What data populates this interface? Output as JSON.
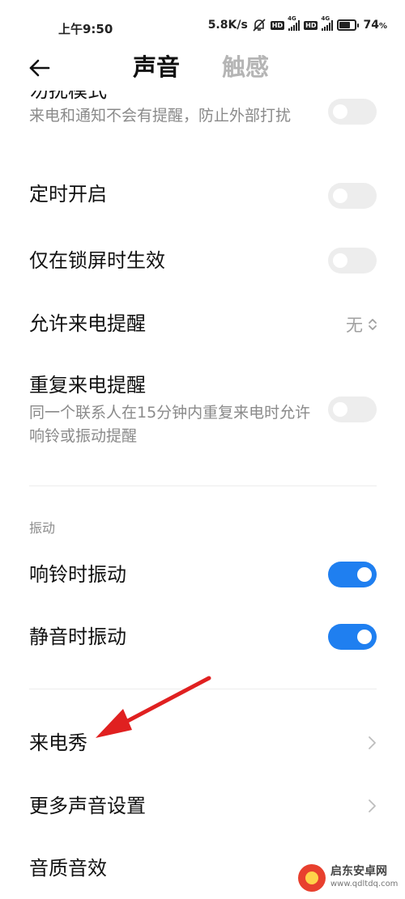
{
  "status_bar": {
    "time": "上午9:50",
    "network_speed": "5.8K/s",
    "hd_badge": "HD",
    "signal_tag": "4G",
    "battery_percent": "74",
    "battery_unit": "%",
    "battery_level": 0.74,
    "icons": [
      "mute-bell-icon",
      "hd-icon",
      "signal-4g-icon",
      "hd-icon",
      "signal-4g-icon",
      "battery-icon"
    ]
  },
  "header": {
    "back_icon": "back-arrow-icon",
    "tab_sound": "声音",
    "tab_haptic": "触感"
  },
  "dnd": {
    "title_partial": "勿扰模式",
    "subtitle": "来电和通知不会有提醒，防止外部打扰",
    "enabled": false
  },
  "settings": {
    "scheduled": {
      "title": "定时开启",
      "enabled": false
    },
    "lock_only": {
      "title": "仅在锁屏时生效",
      "enabled": false
    },
    "allow_calls": {
      "title": "允许来电提醒",
      "value": "无"
    },
    "repeat_calls": {
      "title": "重复来电提醒",
      "subtitle": "同一个联系人在15分钟内重复来电时允许响铃或振动提醒",
      "enabled": false
    }
  },
  "vibration": {
    "section_label": "振动",
    "ring_vibrate": {
      "title": "响铃时振动",
      "enabled": true
    },
    "silent_vibrate": {
      "title": "静音时振动",
      "enabled": true
    }
  },
  "more": {
    "caller_show": {
      "title": "来电秀"
    },
    "more_sound": {
      "title": "更多声音设置"
    },
    "audio_quality": {
      "title": "音质音效"
    }
  },
  "annotation": {
    "color": "#e02020"
  },
  "watermark": {
    "name": "启东安卓网",
    "url": "www.qdltdq.com"
  },
  "colors": {
    "accent": "#1f7ff0",
    "toggle_off": "#ededed",
    "secondary_text": "#8a8a8a",
    "tab_inactive": "#b5b5b5"
  }
}
